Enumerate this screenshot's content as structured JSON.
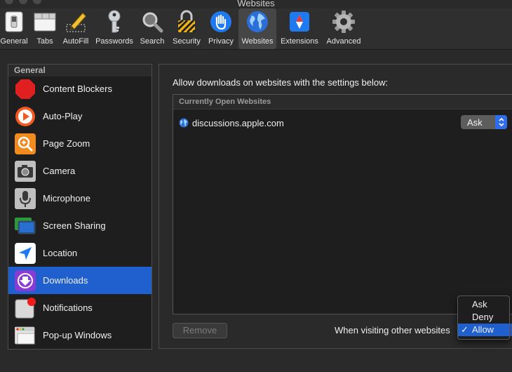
{
  "window": {
    "title": "Websites"
  },
  "toolbar": {
    "items": [
      {
        "label": "General",
        "icon": "general-switch-icon"
      },
      {
        "label": "Tabs",
        "icon": "tabs-icon"
      },
      {
        "label": "AutoFill",
        "icon": "autofill-pencil-icon"
      },
      {
        "label": "Passwords",
        "icon": "key-icon"
      },
      {
        "label": "Search",
        "icon": "magnifier-icon"
      },
      {
        "label": "Security",
        "icon": "lock-icon"
      },
      {
        "label": "Privacy",
        "icon": "hand-icon"
      },
      {
        "label": "Websites",
        "icon": "globe-icon",
        "selected": true
      },
      {
        "label": "Extensions",
        "icon": "extensions-icon"
      },
      {
        "label": "Advanced",
        "icon": "gear-icon"
      }
    ]
  },
  "sidebar": {
    "header": "General",
    "items": [
      {
        "label": "Content Blockers",
        "icon": "stop-sign-icon"
      },
      {
        "label": "Auto-Play",
        "icon": "play-icon"
      },
      {
        "label": "Page Zoom",
        "icon": "zoom-icon"
      },
      {
        "label": "Camera",
        "icon": "camera-icon"
      },
      {
        "label": "Microphone",
        "icon": "microphone-icon"
      },
      {
        "label": "Screen Sharing",
        "icon": "screen-sharing-icon"
      },
      {
        "label": "Location",
        "icon": "location-arrow-icon"
      },
      {
        "label": "Downloads",
        "icon": "download-icon",
        "selected": true
      },
      {
        "label": "Notifications",
        "icon": "notification-icon"
      },
      {
        "label": "Pop-up Windows",
        "icon": "popup-window-icon"
      }
    ]
  },
  "main": {
    "description": "Allow downloads on websites with the settings below:",
    "table": {
      "header": "Currently Open Websites",
      "rows": [
        {
          "site": "discussions.apple.com",
          "setting": "Ask"
        }
      ]
    },
    "remove_label": "Remove",
    "other_websites_label": "When visiting other websites",
    "popup": {
      "options": [
        "Ask",
        "Deny",
        "Allow"
      ],
      "selected": "Allow",
      "check": "✓"
    }
  },
  "colors": {
    "accent": "#1f5fce",
    "background": "#2a2a2a",
    "list_background": "#1e1e1e"
  }
}
